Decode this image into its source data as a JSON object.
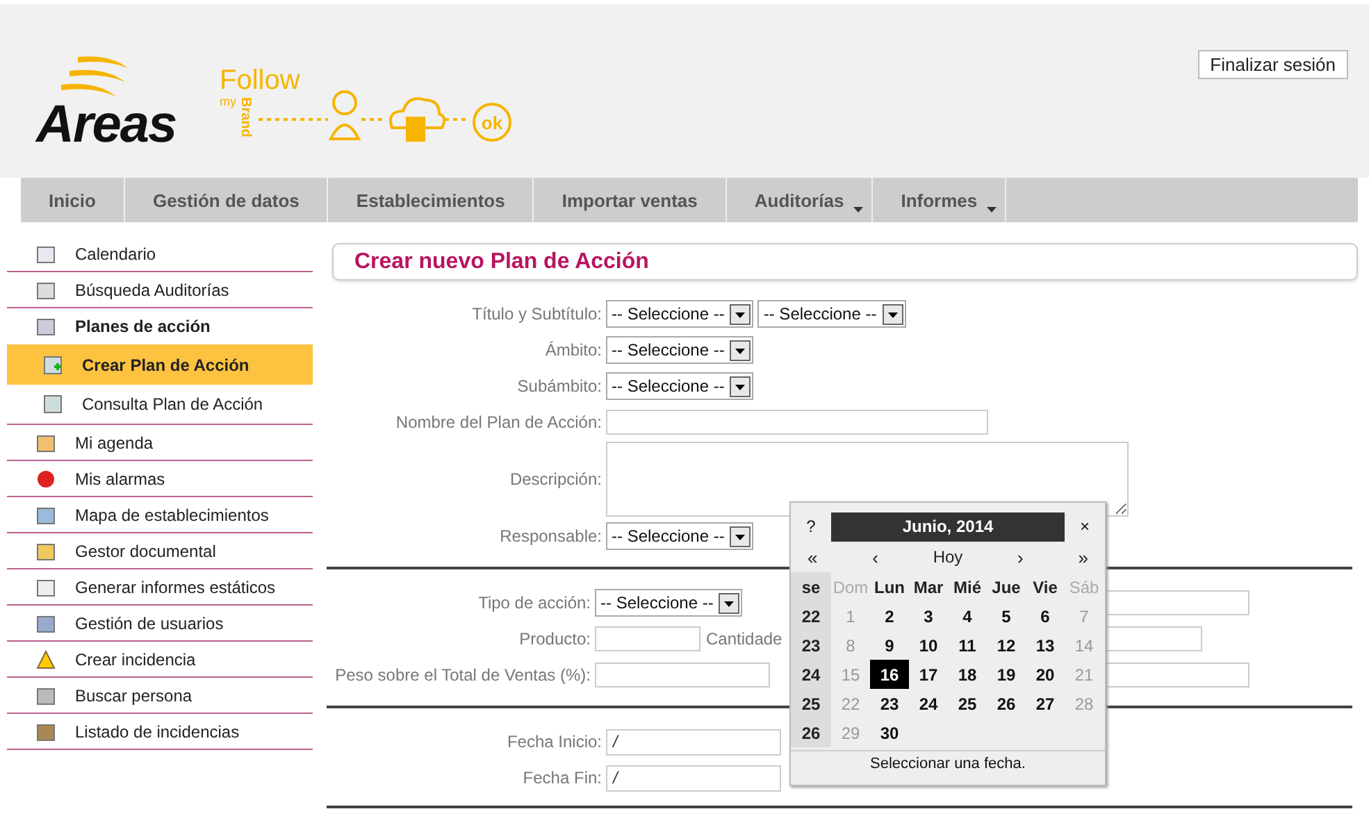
{
  "header": {
    "logo": "Areas",
    "brand_word": "Follow",
    "brand_small": "my",
    "brand_vertical": "Brand",
    "ok_mark": "ok",
    "logout_button": "Finalizar sesión"
  },
  "nav": [
    {
      "label": "Inicio",
      "has_menu": false
    },
    {
      "label": "Gestión de datos",
      "has_menu": false
    },
    {
      "label": "Establecimientos",
      "has_menu": false
    },
    {
      "label": "Importar ventas",
      "has_menu": false
    },
    {
      "label": "Auditorías",
      "has_menu": true
    },
    {
      "label": "Informes",
      "has_menu": true
    }
  ],
  "sidebar": {
    "items": [
      {
        "label": "Calendario",
        "selected": false
      },
      {
        "label": "Búsqueda Auditorías",
        "selected": false
      },
      {
        "label": "Planes de acción",
        "selected": false,
        "children": [
          {
            "label": "Crear Plan de Acción",
            "selected": true
          },
          {
            "label": "Consulta Plan de Acción",
            "selected": false
          }
        ]
      },
      {
        "label": "Mi agenda",
        "selected": false
      },
      {
        "label": "Mis alarmas",
        "selected": false
      },
      {
        "label": "Mapa de establecimientos",
        "selected": false
      },
      {
        "label": "Gestor documental",
        "selected": false
      },
      {
        "label": "Generar informes estáticos",
        "selected": false
      },
      {
        "label": "Gestión de usuarios",
        "selected": false
      },
      {
        "label": "Crear incidencia",
        "selected": false
      },
      {
        "label": "Buscar persona",
        "selected": false
      },
      {
        "label": "Listado de incidencias",
        "selected": false
      }
    ]
  },
  "form": {
    "title": "Crear nuevo Plan de Acción",
    "sections": [
      {
        "rows": [
          {
            "label": "Título y Subtítulo:",
            "controls": [
              {
                "kind": "select",
                "value": "-- Seleccione --"
              },
              {
                "kind": "select",
                "value": "-- Seleccione --"
              }
            ]
          },
          {
            "label": "Ámbito:",
            "controls": [
              {
                "kind": "select",
                "value": "-- Seleccione --"
              }
            ]
          },
          {
            "label": "Subámbito:",
            "controls": [
              {
                "kind": "select",
                "value": "-- Seleccione --"
              }
            ]
          },
          {
            "label": "Nombre del Plan de Acción:",
            "controls": [
              {
                "kind": "text"
              }
            ]
          },
          {
            "label": "Descripción:",
            "controls": [
              {
                "kind": "textarea"
              }
            ]
          },
          {
            "label": "Responsable:",
            "controls": [
              {
                "kind": "select",
                "value": "-- Seleccione --"
              }
            ]
          }
        ]
      },
      {
        "rows": [
          {
            "label": "Tipo de acción:",
            "controls": [
              {
                "kind": "select",
                "value": "-- Seleccione --"
              },
              {
                "kind": "far-text"
              }
            ]
          },
          {
            "label": "Producto:",
            "controls": [
              {
                "kind": "short-text"
              },
              {
                "kind": "inline-label",
                "value": "Cantidade"
              },
              {
                "kind": "mid-text"
              }
            ]
          },
          {
            "label": "Peso sobre el Total de Ventas (%):",
            "controls": [
              {
                "kind": "text-small"
              },
              {
                "kind": "far-text"
              }
            ]
          }
        ]
      },
      {
        "rows": [
          {
            "label": "Fecha Inicio:",
            "controls": [
              {
                "kind": "date",
                "value": "/"
              }
            ]
          },
          {
            "label": "Fecha Fin:",
            "controls": [
              {
                "kind": "date",
                "value": "/"
              }
            ]
          }
        ]
      }
    ]
  },
  "calendar": {
    "help": "?",
    "title": "Junio, 2014",
    "close": "×",
    "prev_year": "«",
    "prev_month": "‹",
    "today": "Hoy",
    "next_month": "›",
    "next_year": "»",
    "week_heading": "se",
    "day_names": [
      {
        "label": "Dom",
        "weekend": true
      },
      {
        "label": "Lun",
        "weekend": false
      },
      {
        "label": "Mar",
        "weekend": false
      },
      {
        "label": "Mié",
        "weekend": false
      },
      {
        "label": "Jue",
        "weekend": false
      },
      {
        "label": "Vie",
        "weekend": false
      },
      {
        "label": "Sáb",
        "weekend": true
      }
    ],
    "weeks": [
      {
        "week": "22",
        "days": [
          {
            "day": "1",
            "weekend": true,
            "selected": false
          },
          {
            "day": "2",
            "weekend": false,
            "selected": false
          },
          {
            "day": "3",
            "weekend": false,
            "selected": false
          },
          {
            "day": "4",
            "weekend": false,
            "selected": false
          },
          {
            "day": "5",
            "weekend": false,
            "selected": false
          },
          {
            "day": "6",
            "weekend": false,
            "selected": false
          },
          {
            "day": "7",
            "weekend": true,
            "selected": false
          }
        ]
      },
      {
        "week": "23",
        "days": [
          {
            "day": "8",
            "weekend": true,
            "selected": false
          },
          {
            "day": "9",
            "weekend": false,
            "selected": false
          },
          {
            "day": "10",
            "weekend": false,
            "selected": false
          },
          {
            "day": "11",
            "weekend": false,
            "selected": false
          },
          {
            "day": "12",
            "weekend": false,
            "selected": false
          },
          {
            "day": "13",
            "weekend": false,
            "selected": false
          },
          {
            "day": "14",
            "weekend": true,
            "selected": false
          }
        ]
      },
      {
        "week": "24",
        "days": [
          {
            "day": "15",
            "weekend": true,
            "selected": false
          },
          {
            "day": "16",
            "weekend": false,
            "selected": true
          },
          {
            "day": "17",
            "weekend": false,
            "selected": false
          },
          {
            "day": "18",
            "weekend": false,
            "selected": false
          },
          {
            "day": "19",
            "weekend": false,
            "selected": false
          },
          {
            "day": "20",
            "weekend": false,
            "selected": false
          },
          {
            "day": "21",
            "weekend": true,
            "selected": false
          }
        ]
      },
      {
        "week": "25",
        "days": [
          {
            "day": "22",
            "weekend": true,
            "selected": false
          },
          {
            "day": "23",
            "weekend": false,
            "selected": false
          },
          {
            "day": "24",
            "weekend": false,
            "selected": false
          },
          {
            "day": "25",
            "weekend": false,
            "selected": false
          },
          {
            "day": "26",
            "weekend": false,
            "selected": false
          },
          {
            "day": "27",
            "weekend": false,
            "selected": false
          },
          {
            "day": "28",
            "weekend": true,
            "selected": false
          }
        ]
      },
      {
        "week": "26",
        "days": [
          {
            "day": "29",
            "weekend": true,
            "selected": false
          },
          {
            "day": "30",
            "weekend": false,
            "selected": false
          }
        ]
      }
    ],
    "footer": "Seleccionar una fecha."
  }
}
